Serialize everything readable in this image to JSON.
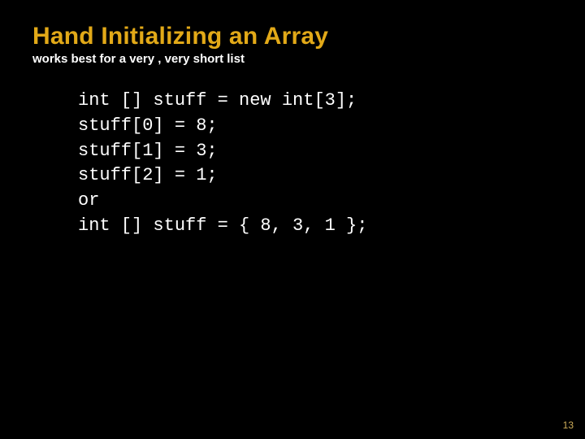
{
  "title": "Hand Initializing an Array",
  "subtitle": "works best for a very , very short list",
  "code": "int [] stuff = new int[3];\nstuff[0] = 8;\nstuff[1] = 3;\nstuff[2] = 1;\nor\nint [] stuff = { 8, 3, 1 };",
  "page_number": "13"
}
